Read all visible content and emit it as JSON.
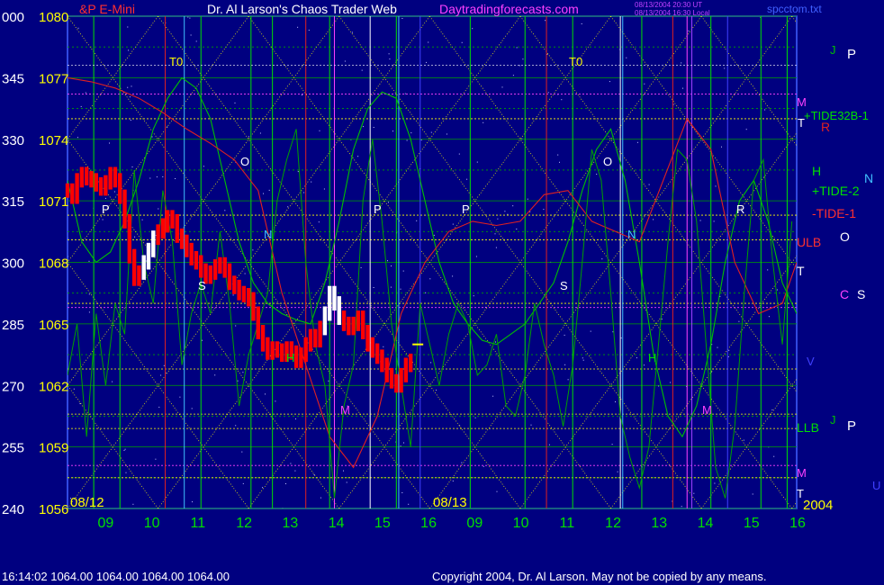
{
  "header": {
    "left_partial": "&P E-Mini",
    "title": "Dr. Al Larson's Chaos Trader Web",
    "site": "Daytradingforecasts.com",
    "stamp_line1": "08/13/2004 20:30 UT",
    "stamp_line2": "08/13/2004 16:30 Local",
    "filename": "spcctom.txt"
  },
  "footer": {
    "quote_line": "16:14:02  1064.00 1064.00 1064.00 1064.00",
    "copyright": "Copyright 2004, Dr. Al Larson. May not be copied by any means."
  },
  "colors": {
    "background": "#000080",
    "price_bar": "#ff0000",
    "price_bar_highlight": "#ffffff",
    "tide_line": "#00c000",
    "red_line": "#e02020",
    "grid_yellow": "#ffff00",
    "grid_magenta": "#ff40ff",
    "axis_green": "#00e000"
  },
  "chart_data": {
    "type": "line",
    "title": "Dr. Al Larson's Chaos Trader Web",
    "instrument": "S&P E-Mini",
    "ylim": [
      1056,
      1080
    ],
    "y_ticks": [
      {
        "deg": "000",
        "price": 1080
      },
      {
        "deg": "345",
        "price": 1077
      },
      {
        "deg": "330",
        "price": 1074
      },
      {
        "deg": "315",
        "price": 1071
      },
      {
        "deg": "300",
        "price": 1068
      },
      {
        "deg": "285",
        "price": 1065
      },
      {
        "deg": "270",
        "price": 1062
      },
      {
        "deg": "255",
        "price": 1059
      },
      {
        "deg": "240",
        "price": 1056
      }
    ],
    "x_ticks": [
      "09",
      "10",
      "11",
      "12",
      "13",
      "14",
      "15",
      "16",
      "09",
      "10",
      "11",
      "12",
      "13",
      "14",
      "15",
      "16"
    ],
    "date_labels": [
      "08/12",
      "08/13",
      "2004"
    ],
    "last_price": 1064.0,
    "series": [
      {
        "name": "price",
        "x": [
          0,
          0.1,
          0.2,
          0.3,
          0.4,
          0.5,
          0.6,
          0.7,
          0.8,
          0.9,
          1.0,
          1.1,
          1.2,
          1.3,
          1.4,
          1.5,
          1.6,
          1.7,
          1.8,
          1.9,
          2.0,
          2.1,
          2.2,
          2.3,
          2.4,
          2.5,
          2.6,
          2.7,
          2.8,
          2.9,
          3.0,
          3.1,
          3.2,
          3.3,
          3.4,
          3.5,
          3.6,
          3.7,
          3.8,
          3.9,
          4.0,
          4.1,
          4.2,
          4.3,
          4.4,
          4.5,
          4.6,
          4.7,
          4.8,
          4.9,
          5.0,
          5.1,
          5.2,
          5.3,
          5.4,
          5.5,
          5.6,
          5.7,
          5.8,
          5.9,
          6.0,
          6.1,
          6.2,
          6.3,
          6.4,
          6.5,
          6.6,
          6.7,
          6.8,
          6.9,
          7.0,
          7.1,
          7.2
        ],
        "values": [
          1071.5,
          1071.2,
          1072.0,
          1072.3,
          1072.1,
          1072.0,
          1071.8,
          1071.6,
          1071.9,
          1072.3,
          1072.0,
          1071.2,
          1070.0,
          1068.3,
          1067.2,
          1067.5,
          1068.0,
          1068.6,
          1069.2,
          1069.5,
          1069.8,
          1070.2,
          1070.0,
          1069.3,
          1069.0,
          1068.6,
          1068.2,
          1068.0,
          1067.6,
          1067.3,
          1067.5,
          1067.8,
          1067.9,
          1067.6,
          1067.0,
          1066.8,
          1066.5,
          1066.4,
          1066.2,
          1065.5,
          1064.6,
          1064.0,
          1063.6,
          1063.8,
          1063.7,
          1063.5,
          1063.8,
          1063.6,
          1063.2,
          1063.5,
          1064.0,
          1064.4,
          1064.2,
          1064.8,
          1065.5,
          1066.5,
          1066.0,
          1065.3,
          1065.0,
          1064.8,
          1065.0,
          1065.3,
          1064.6,
          1064.0,
          1063.7,
          1063.4,
          1063.0,
          1062.5,
          1062.2,
          1062.0,
          1062.5,
          1063.0,
          1063.2
        ]
      },
      {
        "name": "TIDE",
        "x": [
          0,
          0.3,
          0.6,
          0.9,
          1.2,
          1.5,
          1.8,
          2.1,
          2.4,
          2.7,
          3.0,
          3.3,
          3.6,
          3.9,
          4.2,
          4.5,
          4.8,
          5.1,
          5.4,
          5.7,
          6.0,
          6.3,
          6.6,
          6.9,
          7.2,
          7.5,
          7.8,
          8.1,
          8.4,
          8.7,
          9.0,
          9.3,
          9.6,
          9.9,
          10.2,
          10.5,
          10.8,
          11.1,
          11.4,
          11.7,
          12.0,
          12.3,
          12.6,
          12.9,
          13.2,
          13.5,
          13.8,
          14.1,
          14.4,
          14.7,
          15.0,
          15.3
        ],
        "values": [
          1072.0,
          1069.0,
          1068.0,
          1068.5,
          1070.0,
          1072.0,
          1074.5,
          1076.0,
          1077.0,
          1076.5,
          1075.0,
          1072.0,
          1069.0,
          1067.0,
          1066.0,
          1065.5,
          1065.2,
          1065.0,
          1067.0,
          1070.0,
          1073.5,
          1075.5,
          1076.3,
          1076.0,
          1074.0,
          1071.0,
          1068.0,
          1066.0,
          1065.0,
          1064.2,
          1064.0,
          1064.5,
          1065.0,
          1066.0,
          1067.0,
          1069.0,
          1071.5,
          1073.5,
          1074.5,
          1072.0,
          1068.0,
          1063.5,
          1060.5,
          1059.5,
          1061.0,
          1064.0,
          1068.0,
          1071.0,
          1072.0,
          1070.0,
          1067.0,
          1065.5
        ]
      },
      {
        "name": "-TIDE-1",
        "x": [
          0,
          0.5,
          1.0,
          1.5,
          2.0,
          2.5,
          3.0,
          3.5,
          4.0,
          4.5,
          5.0,
          5.5,
          6.0,
          6.5,
          7.0,
          7.5,
          8.0,
          8.5,
          9.0,
          9.5,
          10.0,
          10.5,
          11.0,
          11.5,
          12.0,
          12.5,
          13.0,
          13.5,
          14.0,
          14.5,
          15.0,
          15.3
        ],
        "values": [
          1077.0,
          1076.8,
          1076.5,
          1076.0,
          1075.3,
          1074.5,
          1073.8,
          1073.0,
          1071.5,
          1066.5,
          1063.0,
          1059.5,
          1058.0,
          1060.5,
          1065.5,
          1068.0,
          1069.5,
          1070.0,
          1069.8,
          1070.0,
          1071.3,
          1071.5,
          1070.0,
          1069.5,
          1069.0,
          1072.0,
          1075.0,
          1073.5,
          1068.0,
          1065.5,
          1066.0,
          1068.0
        ]
      },
      {
        "name": "+TIDE32B-1",
        "x": [
          0,
          0.2,
          0.4,
          0.6,
          0.8,
          1.0,
          1.2,
          1.4,
          1.6,
          1.8,
          2.0,
          2.2,
          2.4,
          2.6,
          2.8,
          3.0,
          3.2,
          3.4,
          3.6,
          3.8,
          4.0,
          4.2,
          4.4,
          4.6,
          4.8,
          5.0,
          5.2,
          5.4,
          5.6,
          5.8,
          6.0,
          6.2,
          6.4,
          6.6,
          6.8,
          7.0,
          7.2,
          7.4,
          7.6,
          7.8,
          8.0,
          8.2,
          8.4,
          8.6,
          8.8,
          9.0,
          9.2,
          9.4,
          9.6,
          9.8,
          10.0,
          10.2,
          10.4,
          10.6,
          10.8,
          11.0,
          11.2,
          11.4,
          11.6,
          11.8,
          12.0,
          12.2,
          12.4,
          12.6,
          12.8,
          13.0,
          13.2,
          13.4,
          13.6,
          13.8,
          14.0,
          14.2,
          14.4,
          14.6,
          14.8,
          15.0,
          15.2
        ],
        "values": [
          1062.5,
          1065.0,
          1059.5,
          1065.5,
          1062.0,
          1066.0,
          1064.5,
          1072.5,
          1068.0,
          1066.0,
          1071.5,
          1069.0,
          1063.0,
          1065.5,
          1067.0,
          1065.5,
          1069.5,
          1066.0,
          1061.0,
          1063.5,
          1065.0,
          1066.5,
          1071.0,
          1073.0,
          1074.5,
          1068.0,
          1064.0,
          1062.0,
          1056.5,
          1061.0,
          1063.0,
          1071.0,
          1074.0,
          1070.0,
          1065.0,
          1062.0,
          1059.0,
          1066.0,
          1064.0,
          1062.0,
          1064.5,
          1066.0,
          1065.0,
          1062.5,
          1063.0,
          1064.5,
          1061.0,
          1060.5,
          1062.5,
          1066.0,
          1064.0,
          1062.5,
          1060.0,
          1063.0,
          1068.0,
          1073.5,
          1072.0,
          1066.5,
          1060.5,
          1058.5,
          1057.0,
          1059.0,
          1064.0,
          1069.0,
          1073.5,
          1073.0,
          1070.0,
          1064.0,
          1058.0,
          1056.5,
          1060.0,
          1066.5,
          1072.0,
          1073.0,
          1068.0,
          1064.0,
          1070.0
        ]
      }
    ],
    "grid_on": true
  },
  "right_labels": [
    {
      "text": "J",
      "color": "#00c000"
    },
    {
      "text": "P",
      "color": "#ffffff"
    },
    {
      "text": "M",
      "color": "#ff40ff"
    },
    {
      "text": "+TIDE32B-1",
      "color": "#00e000"
    },
    {
      "text": "T",
      "color": "#ffffff"
    },
    {
      "text": "R",
      "color": "#e02020"
    },
    {
      "text": "H",
      "color": "#00e000"
    },
    {
      "text": "+TIDE-2",
      "color": "#00e000"
    },
    {
      "text": "N",
      "color": "#40c0ff"
    },
    {
      "text": "-TIDE-1",
      "color": "#ff3030"
    },
    {
      "text": "ULB",
      "color": "#ff3030"
    },
    {
      "text": "O",
      "color": "#ffffff"
    },
    {
      "text": "T",
      "color": "#ffffff"
    },
    {
      "text": "C",
      "color": "#ff40ff"
    },
    {
      "text": "S",
      "color": "#ffffff"
    },
    {
      "text": "V",
      "color": "#4040ff"
    },
    {
      "text": "LLB",
      "color": "#00e000"
    },
    {
      "text": "J",
      "color": "#00c000"
    },
    {
      "text": "P",
      "color": "#ffffff"
    },
    {
      "text": "M",
      "color": "#ff40ff"
    },
    {
      "text": "T",
      "color": "#ffffff"
    },
    {
      "text": "U",
      "color": "#4040ff"
    }
  ],
  "chart_letters": [
    {
      "text": "T0",
      "color": "#ffff00"
    },
    {
      "text": "T0",
      "color": "#ffff00"
    },
    {
      "text": "O",
      "color": "#ffffff"
    },
    {
      "text": "O",
      "color": "#ffffff"
    },
    {
      "text": "P",
      "color": "#ffffff"
    },
    {
      "text": "P",
      "color": "#ffffff"
    },
    {
      "text": "P",
      "color": "#ffffff"
    },
    {
      "text": "R",
      "color": "#ffffff"
    },
    {
      "text": "N",
      "color": "#40c0ff"
    },
    {
      "text": "N",
      "color": "#40c0ff"
    },
    {
      "text": "S",
      "color": "#ffffff"
    },
    {
      "text": "S",
      "color": "#ffffff"
    },
    {
      "text": "M",
      "color": "#ff40ff"
    },
    {
      "text": "M",
      "color": "#ff40ff"
    },
    {
      "text": "H",
      "color": "#00e000"
    },
    {
      "text": "H",
      "color": "#00e000"
    }
  ]
}
